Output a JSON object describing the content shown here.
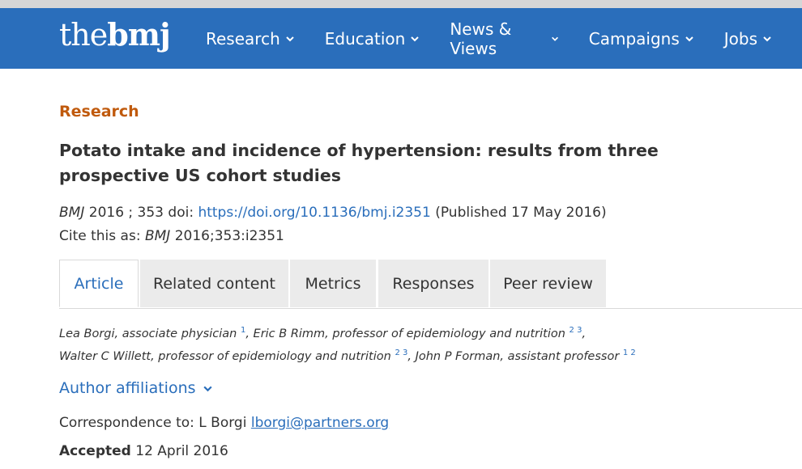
{
  "brand": {
    "logo_the": "the",
    "logo_bmj": "bmj"
  },
  "nav": {
    "items": [
      {
        "label": "Research"
      },
      {
        "label": "Education"
      },
      {
        "label": "News & Views"
      },
      {
        "label": "Campaigns"
      },
      {
        "label": "Jobs"
      }
    ]
  },
  "article": {
    "section": "Research",
    "title": "Potato intake and incidence of hypertension: results from three prospective US cohort studies",
    "journal": "BMJ",
    "year_volume": " 2016 ; 353  doi: ",
    "doi_url": "https://doi.org/10.1136/bmj.i2351",
    "published": " (Published 17 May 2016)",
    "cite_prefix": "Cite this as: ",
    "cite_journal": "BMJ",
    "cite_ref": " 2016;353:i2351"
  },
  "tabs": [
    {
      "label": "Article",
      "active": true
    },
    {
      "label": "Related content",
      "active": false
    },
    {
      "label": "Metrics",
      "active": false
    },
    {
      "label": "Responses",
      "active": false
    },
    {
      "label": "Peer review",
      "active": false
    }
  ],
  "authors": {
    "line1": [
      {
        "name": "Lea Borgi, associate physician",
        "sup": "1"
      },
      {
        "sep": ",  "
      },
      {
        "name": "Eric B Rimm, professor of epidemiology and nutrition",
        "sup": "2 3"
      },
      {
        "sep": ","
      }
    ],
    "line2": [
      {
        "name": "Walter C Willett, professor of epidemiology and nutrition",
        "sup": "2 3"
      },
      {
        "sep": ",  "
      },
      {
        "name": "John P Forman, assistant professor",
        "sup": "1 2"
      }
    ]
  },
  "affiliations_label": "Author affiliations",
  "correspondence": {
    "prefix": "Correspondence to: L Borgi ",
    "email": "lborgi@partners.org"
  },
  "accepted": {
    "label": "Accepted",
    "date": " 12 April 2016"
  },
  "colors": {
    "brand_blue": "#2a6ebb",
    "section_orange": "#c05a0d",
    "tab_bg": "#ebebeb"
  },
  "icons": {
    "nav_chevron": "chevron-down-icon",
    "affil_chevron": "chevron-down-icon"
  }
}
